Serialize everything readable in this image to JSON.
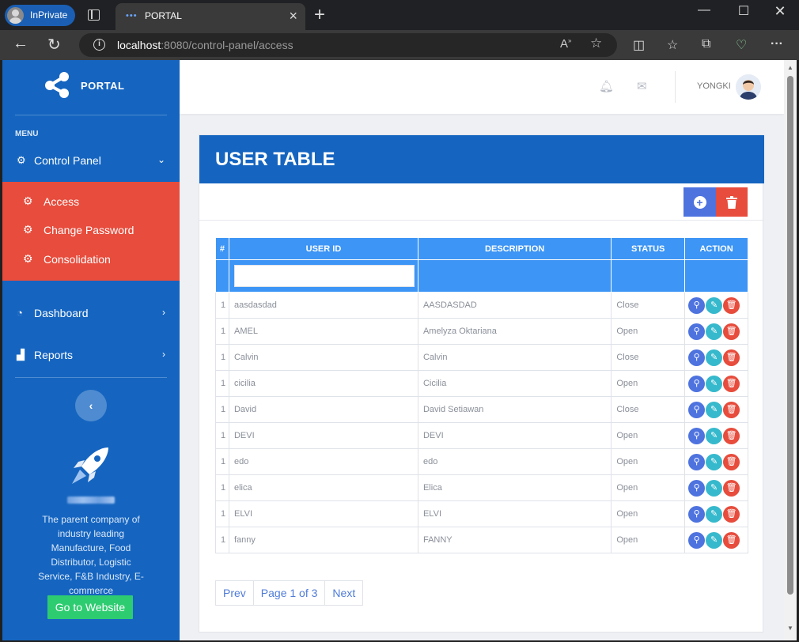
{
  "browser": {
    "inprivate_label": "InPrivate",
    "tab_title": "PORTAL",
    "url_host": "localhost",
    "url_rest": ":8080/control-panel/access"
  },
  "sidebar": {
    "brand": "PORTAL",
    "menu_label": "MENU",
    "control_panel": "Control Panel",
    "sub_items": [
      {
        "label": "Access",
        "icon": "gear-icon"
      },
      {
        "label": "Change Password",
        "icon": "gear-icon"
      },
      {
        "label": "Consolidation",
        "icon": "gear-icon"
      }
    ],
    "dashboard": "Dashboard",
    "reports": "Reports",
    "about_text": "The parent company of industry leading Manufacture, Food Distributor, Logistic Service, F&B Industry, E-commerce",
    "go_website": "Go to Website"
  },
  "topbar": {
    "username": "YONGKI"
  },
  "card": {
    "title": "USER TABLE",
    "columns": [
      "#",
      "USER ID",
      "DESCRIPTION",
      "STATUS",
      "ACTION"
    ],
    "rows": [
      {
        "no": "1",
        "user_id": "aasdasdad",
        "description": "AASDASDAD",
        "status": "Close"
      },
      {
        "no": "1",
        "user_id": "AMEL",
        "description": "Amelyza Oktariana",
        "status": "Open"
      },
      {
        "no": "1",
        "user_id": "Calvin",
        "description": "Calvin",
        "status": "Close"
      },
      {
        "no": "1",
        "user_id": "cicilia",
        "description": "Cicilia",
        "status": "Open"
      },
      {
        "no": "1",
        "user_id": "David",
        "description": "David Setiawan",
        "status": "Close"
      },
      {
        "no": "1",
        "user_id": "DEVI",
        "description": "DEVI",
        "status": "Open"
      },
      {
        "no": "1",
        "user_id": "edo",
        "description": "edo",
        "status": "Open"
      },
      {
        "no": "1",
        "user_id": "elica",
        "description": "Elica",
        "status": "Open"
      },
      {
        "no": "1",
        "user_id": "ELVI",
        "description": "ELVI",
        "status": "Open"
      },
      {
        "no": "1",
        "user_id": "fanny",
        "description": "FANNY",
        "status": "Open"
      }
    ],
    "pager": {
      "prev": "Prev",
      "page": "Page 1 of 3",
      "next": "Next"
    }
  },
  "colors": {
    "sidebar": "#1565c0",
    "submenu": "#e74c3c",
    "table_header": "#3d95f5",
    "go_button": "#2ecc71"
  }
}
